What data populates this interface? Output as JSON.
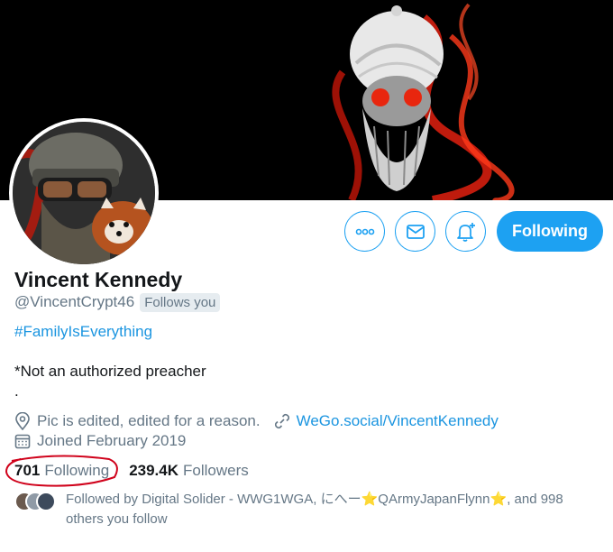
{
  "profile": {
    "name": "Vincent Kennedy",
    "handle": "@VincentCrypt46",
    "follows_you_badge": "Follows you",
    "hashtag": "#FamilyIsEverything",
    "bio_line1": "*Not an authorized preacher",
    "bio_line2": ".",
    "location": "Pic is edited, edited for a reason.",
    "website": "WeGo.social/VincentKennedy",
    "joined": "Joined February 2019"
  },
  "actions": {
    "following_label": "Following"
  },
  "stats": {
    "following_count": "701",
    "following_label": "Following",
    "followers_count": "239.4K",
    "followers_label": "Followers"
  },
  "followed_by": {
    "prefix": "Followed by Digital Solider - WWG1WGA, に",
    "name2": "へー",
    "star1": "⭐",
    "name3": "QArmyJapanFlynn",
    "star2": "⭐",
    "suffix": ", and 998 others you follow"
  },
  "icons": {
    "more": "more-icon",
    "message": "mail-icon",
    "notify": "bell-plus-icon",
    "location": "location-pin-icon",
    "link": "link-icon",
    "calendar": "calendar-icon"
  },
  "colors": {
    "accent": "#1da1f2",
    "link": "#1b95e0",
    "secondary_text": "#657786",
    "annotation": "#d0021b"
  }
}
